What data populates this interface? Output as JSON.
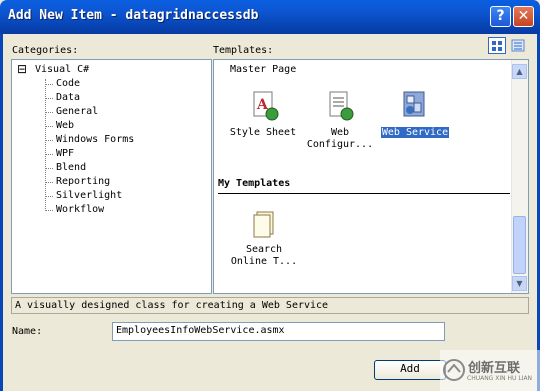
{
  "window": {
    "title": "Add New Item - datagridnaccessdb"
  },
  "title_buttons": {
    "help": "?",
    "close": "✕"
  },
  "categories": {
    "label": "Categories:",
    "root": {
      "expander": "⊟",
      "label": "Visual C#"
    },
    "items": [
      "Code",
      "Data",
      "General",
      "Web",
      "Windows Forms",
      "WPF",
      "Blend",
      "Reporting",
      "Silverlight",
      "Workflow"
    ]
  },
  "templates": {
    "label": "Templates:",
    "partial_top": "Master Page",
    "items": [
      "Style Sheet",
      "Web\nConfigur...",
      "Web Service"
    ],
    "section": "My Templates",
    "my_items": [
      "Search\nOnline T..."
    ]
  },
  "description": "A visually designed class for creating a Web Service",
  "name_field": {
    "label": "Name:",
    "value": "EmployeesInfoWebService.asmx"
  },
  "buttons": {
    "add": "Add"
  },
  "scroll": {
    "up": "▲",
    "down": "▼"
  },
  "watermark": {
    "text": "创新互联",
    "sub": "CHUANG XIN HU LIAN"
  }
}
